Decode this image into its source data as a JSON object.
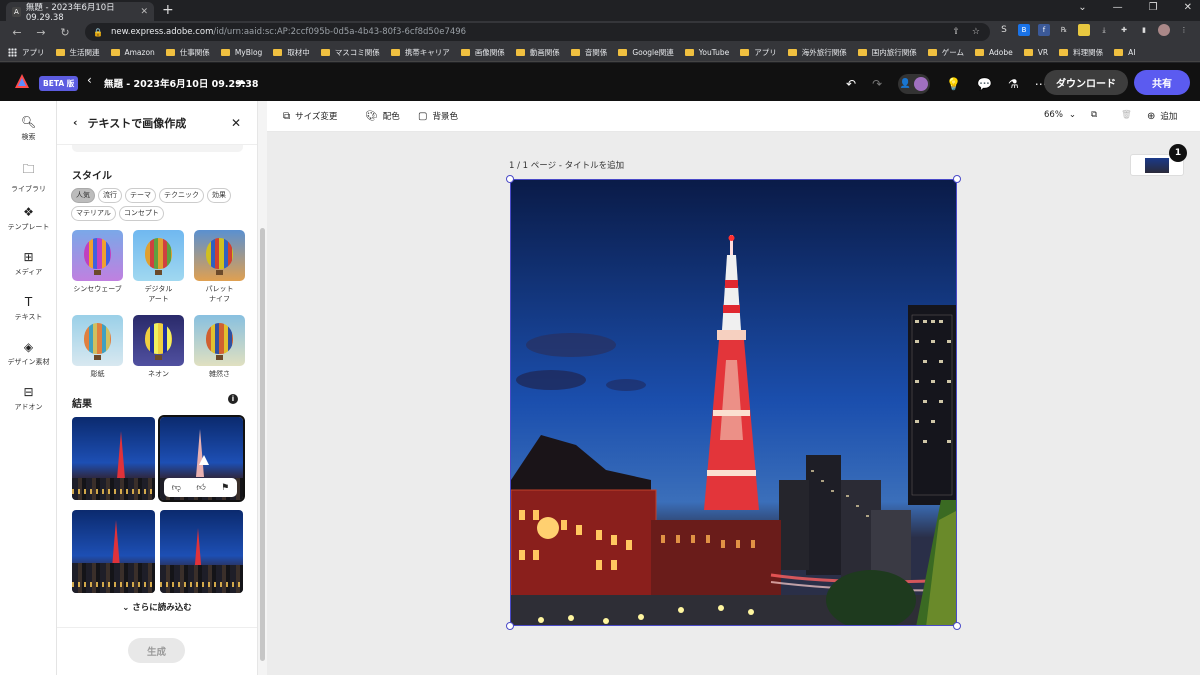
{
  "browser": {
    "tab_title": "無題 - 2023年6月10日 09.29.38",
    "url_host": "new.express.adobe.com",
    "url_path": "/id/urn:aaid:sc:AP:2ccf095b-0d5a-4b43-80f3-6cf8d50e7496",
    "bookmarks": [
      "アプリ",
      "生活関連",
      "Amazon",
      "仕事関係",
      "MyBlog",
      "取材中",
      "マスコミ関係",
      "携帯キャリア",
      "画像関係",
      "動画関係",
      "音関係",
      "Google関連",
      "YouTube",
      "アプリ",
      "海外旅行関係",
      "国内旅行関係",
      "ゲーム",
      "Adobe",
      "VR",
      "料理関係",
      "AI"
    ]
  },
  "app": {
    "beta_label": "BETA 版",
    "doc_title": "無題 - 2023年6月10日 09.29.38",
    "download_label": "ダウンロード",
    "share_label": "共有"
  },
  "rail": {
    "items": [
      {
        "label": "検索",
        "icon": "search-icon"
      },
      {
        "label": "ライブラリ",
        "icon": "folder-icon"
      },
      {
        "label": "テンプレート",
        "icon": "template-icon"
      },
      {
        "label": "メディア",
        "icon": "media-icon"
      },
      {
        "label": "テキスト",
        "icon": "text-icon"
      },
      {
        "label": "デザイン素材",
        "icon": "shapes-icon"
      },
      {
        "label": "アドオン",
        "icon": "addon-icon"
      }
    ]
  },
  "panel": {
    "title": "テキストで画像作成",
    "style_heading": "スタイル",
    "chips": [
      "人気",
      "流行",
      "テーマ",
      "テクニック",
      "効果",
      "マテリアル",
      "コンセプト"
    ],
    "styles": [
      {
        "label": "シンセウェーブ",
        "color": "#c040c0",
        "bg": "#7aa8e8"
      },
      {
        "label": "デジタル\nアート",
        "color": "#e0a030",
        "bg": "#70b8f0"
      },
      {
        "label": "パレット\nナイフ",
        "color": "#d0c020",
        "bg": "#5a90d0"
      },
      {
        "label": "彫紙",
        "color": "#e08040",
        "bg": "#9ad0e8"
      },
      {
        "label": "ネオン",
        "color": "#f0d040",
        "bg": "#3a3a8a"
      },
      {
        "label": "雑然さ",
        "color": "#d06030",
        "bg": "#88c0e0"
      }
    ],
    "results_heading": "結果",
    "load_more_label": "さらに読み込む",
    "generate_label": "生成"
  },
  "toolbar": {
    "resize_label": "サイズ変更",
    "color_label": "配色",
    "bg_label": "背景色",
    "zoom": "66%",
    "add_label": "追加"
  },
  "canvas": {
    "page_label": "1 / 1 ページ - タイトルを追加",
    "page_count_badge": "1"
  },
  "colors": {
    "accent": "#5b5bf0",
    "selection": "#4a4ac8"
  }
}
